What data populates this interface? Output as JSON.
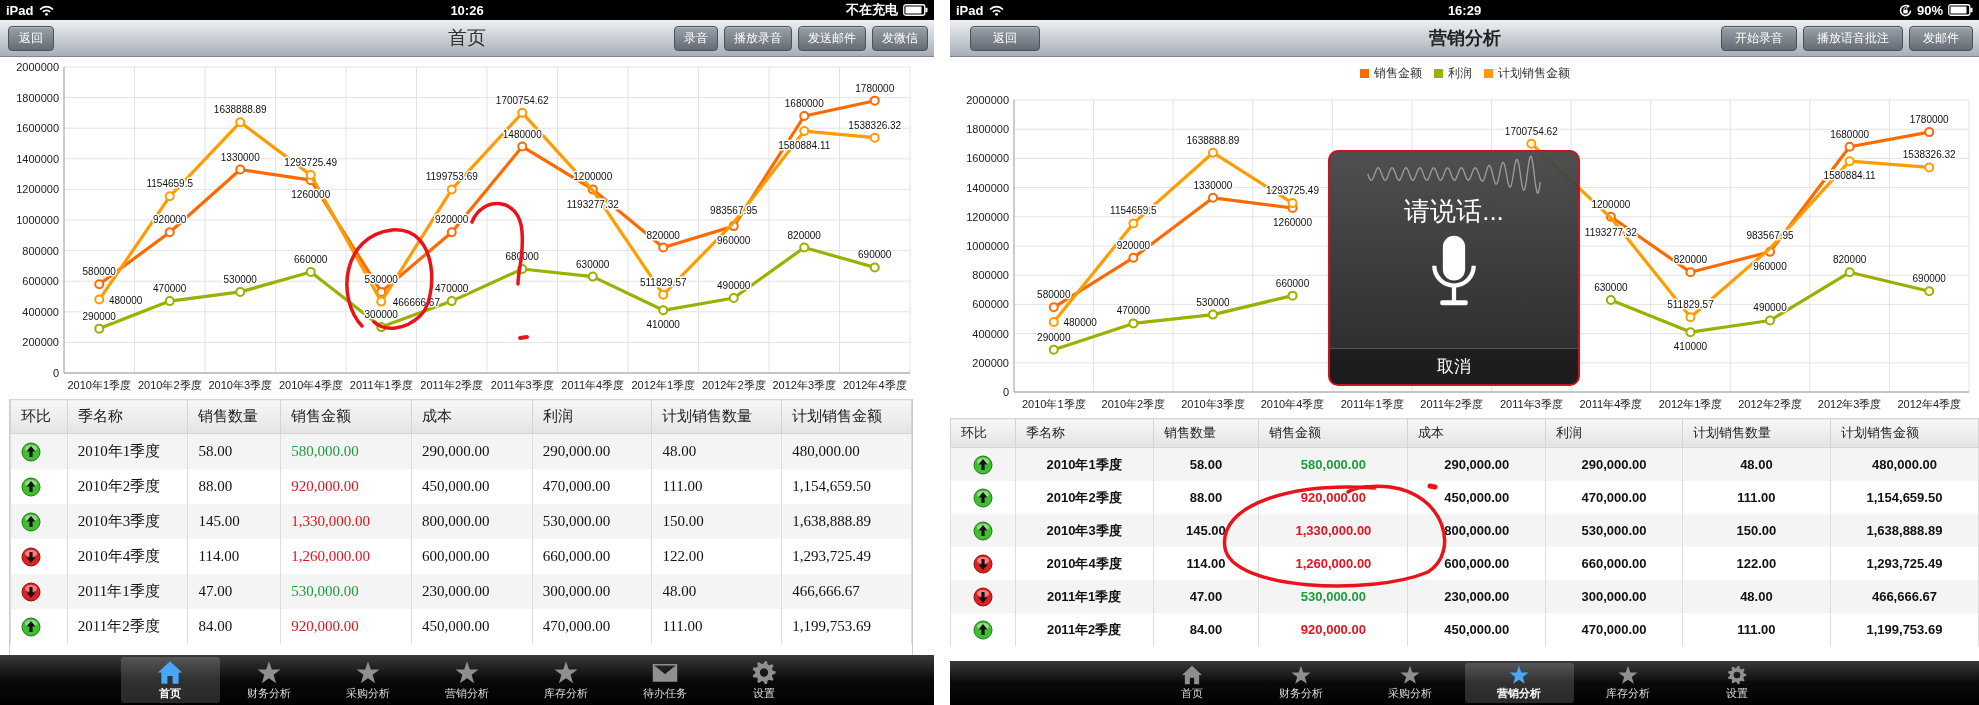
{
  "screens": [
    {
      "status_bar": {
        "device": "iPad",
        "time": "10:26",
        "charge_text": "不在充电"
      },
      "nav_bar": {
        "back": "返回",
        "title": "首页",
        "buttons": [
          "录音",
          "播放录音",
          "发送邮件",
          "发微信"
        ]
      },
      "chart_data": {
        "type": "line",
        "grid": true,
        "categories": [
          "2010年1季度",
          "2010年2季度",
          "2010年3季度",
          "2010年4季度",
          "2011年1季度",
          "2011年2季度",
          "2011年3季度",
          "2011年4季度",
          "2012年1季度",
          "2012年2季度",
          "2012年3季度",
          "2012年4季度"
        ],
        "series": [
          {
            "color": "#ff6a00",
            "marker": true,
            "values": [
              580000,
              920000,
              1330000,
              1260000,
              530000,
              920000,
              1480000,
              1200000,
              820000,
              960000,
              1680000,
              1780000
            ]
          },
          {
            "color": "#9bb000",
            "marker": true,
            "values": [
              290000,
              470000,
              530000,
              660000,
              300000,
              470000,
              680000,
              630000,
              410000,
              490000,
              820000,
              690000
            ]
          },
          {
            "color": "#ff9c00",
            "marker": true,
            "values": [
              480000,
              1154659.5,
              1638888.89,
              1293725.49,
              466666.67,
              1199753.69,
              1700754.62,
              1193277.32,
              511829.57,
              983567.95,
              1580884.11,
              1538326.32
            ]
          }
        ],
        "ylim": [
          0,
          2000000
        ],
        "yticks": [
          0,
          200000,
          400000,
          600000,
          800000,
          1000000,
          1200000,
          1400000,
          1600000,
          1800000,
          2000000
        ],
        "data_labels": true
      },
      "table": {
        "columns": [
          "环比",
          "季名称",
          "销售数量",
          "销售金额",
          "成本",
          "利润",
          "计划销售数量",
          "计划销售金额"
        ],
        "rows": [
          {
            "kind": "up",
            "color": "#1a9e3c",
            "cells": [
              "",
              "2010年1季度",
              "58.00",
              "580,000.00",
              "290,000.00",
              "290,000.00",
              "48.00",
              "480,000.00"
            ]
          },
          {
            "kind": "up",
            "color": "#e0141e",
            "cells": [
              "",
              "2010年2季度",
              "88.00",
              "920,000.00",
              "450,000.00",
              "470,000.00",
              "111.00",
              "1,154,659.50"
            ]
          },
          {
            "kind": "up",
            "color": "#e0141e",
            "cells": [
              "",
              "2010年3季度",
              "145.00",
              "1,330,000.00",
              "800,000.00",
              "530,000.00",
              "150.00",
              "1,638,888.89"
            ]
          },
          {
            "kind": "down",
            "color": "#e0141e",
            "cells": [
              "",
              "2010年4季度",
              "114.00",
              "1,260,000.00",
              "600,000.00",
              "660,000.00",
              "122.00",
              "1,293,725.49"
            ]
          },
          {
            "kind": "down",
            "color": "#1a9e3c",
            "cells": [
              "",
              "2011年1季度",
              "47.00",
              "530,000.00",
              "230,000.00",
              "300,000.00",
              "48.00",
              "466,666.67"
            ]
          },
          {
            "kind": "up",
            "color": "#e0141e",
            "cells": [
              "",
              "2011年2季度",
              "84.00",
              "920,000.00",
              "450,000.00",
              "470,000.00",
              "111.00",
              "1,199,753.69"
            ]
          }
        ]
      },
      "tab_bar": [
        {
          "label": "首页",
          "kind": "home",
          "selected": true
        },
        {
          "label": "财务分析",
          "kind": "star",
          "selected": false
        },
        {
          "label": "采购分析",
          "kind": "star",
          "selected": false
        },
        {
          "label": "营销分析",
          "kind": "star",
          "selected": false
        },
        {
          "label": "库存分析",
          "kind": "star",
          "selected": false
        },
        {
          "label": "待办任务",
          "kind": "mail",
          "selected": false
        },
        {
          "label": "设置",
          "kind": "gear",
          "selected": false
        }
      ]
    },
    {
      "status_bar": {
        "device": "iPad",
        "time": "16:29",
        "charge_text": "90%",
        "rotation_lock": true
      },
      "nav_bar": {
        "back": "返回",
        "title": "营销分析",
        "buttons": [
          "开始录音",
          "播放语音批注",
          "发邮件"
        ]
      },
      "chart_data": {
        "type": "line",
        "grid": true,
        "legend": "top",
        "categories": [
          "2010年1季度",
          "2010年2季度",
          "2010年3季度",
          "2010年4季度",
          "2011年1季度",
          "2011年2季度",
          "2011年3季度",
          "2011年4季度",
          "2012年1季度",
          "2012年2季度",
          "2012年3季度",
          "2012年4季度"
        ],
        "series": [
          {
            "name": "销售金额",
            "color": "#ff6a00",
            "marker": true,
            "values": [
              580000,
              920000,
              1330000,
              1260000,
              null,
              null,
              null,
              1200000,
              820000,
              960000,
              1680000,
              1780000
            ]
          },
          {
            "name": "利润",
            "color": "#9bb000",
            "marker": true,
            "values": [
              290000,
              470000,
              530000,
              660000,
              null,
              null,
              null,
              630000,
              410000,
              490000,
              820000,
              690000
            ]
          },
          {
            "name": "计划销售金额",
            "color": "#ff9c00",
            "marker": true,
            "values": [
              480000,
              1154659.5,
              1638888.89,
              1293725.49,
              null,
              null,
              1700754.62,
              1193277.32,
              511829.57,
              983567.95,
              1580884.11,
              1538326.32
            ]
          }
        ],
        "ylim": [
          0,
          2000000
        ],
        "yticks": [
          0,
          200000,
          400000,
          600000,
          800000,
          1000000,
          1200000,
          1400000,
          1600000,
          1800000,
          2000000
        ],
        "data_labels": true
      },
      "table": {
        "columns": [
          "环比",
          "季名称",
          "销售数量",
          "销售金额",
          "成本",
          "利润",
          "计划销售数量",
          "计划销售金额"
        ],
        "rows": [
          {
            "kind": "up",
            "color": "#1a9e3c",
            "cells": [
              "",
              "2010年1季度",
              "58.00",
              "580,000.00",
              "290,000.00",
              "290,000.00",
              "48.00",
              "480,000.00"
            ]
          },
          {
            "kind": "up",
            "color": "#e0141e",
            "cells": [
              "",
              "2010年2季度",
              "88.00",
              "920,000.00",
              "450,000.00",
              "470,000.00",
              "111.00",
              "1,154,659.50"
            ]
          },
          {
            "kind": "up",
            "color": "#e0141e",
            "cells": [
              "",
              "2010年3季度",
              "145.00",
              "1,330,000.00",
              "800,000.00",
              "530,000.00",
              "150.00",
              "1,638,888.89"
            ]
          },
          {
            "kind": "down",
            "color": "#e0141e",
            "cells": [
              "",
              "2010年4季度",
              "114.00",
              "1,260,000.00",
              "600,000.00",
              "660,000.00",
              "122.00",
              "1,293,725.49"
            ]
          },
          {
            "kind": "down",
            "color": "#1a9e3c",
            "cells": [
              "",
              "2011年1季度",
              "47.00",
              "530,000.00",
              "230,000.00",
              "300,000.00",
              "48.00",
              "466,666.67"
            ]
          },
          {
            "kind": "up",
            "color": "#e0141e",
            "cells": [
              "",
              "2011年2季度",
              "84.00",
              "920,000.00",
              "450,000.00",
              "470,000.00",
              "111.00",
              "1,199,753.69"
            ]
          }
        ]
      },
      "tab_bar": [
        {
          "label": "首页",
          "kind": "home",
          "selected": false
        },
        {
          "label": "财务分析",
          "kind": "star",
          "selected": false
        },
        {
          "label": "采购分析",
          "kind": "star",
          "selected": false
        },
        {
          "label": "营销分析",
          "kind": "star",
          "selected": true
        },
        {
          "label": "库存分析",
          "kind": "star",
          "selected": false
        },
        {
          "label": "设置",
          "kind": "gear",
          "selected": false
        }
      ],
      "voice_dialog": {
        "prompt": "请说话...",
        "cancel": "取消"
      }
    }
  ]
}
